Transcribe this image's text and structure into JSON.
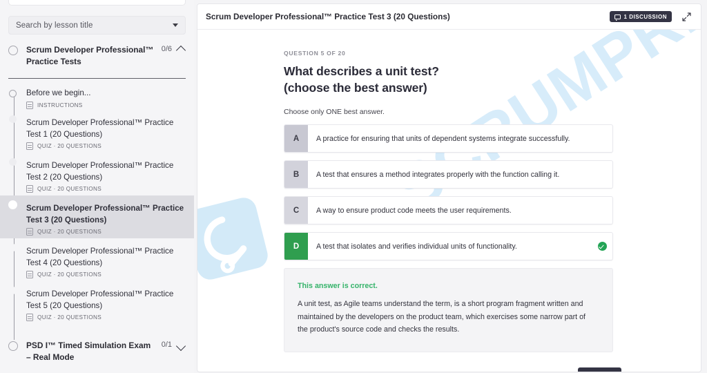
{
  "sidebar": {
    "search": {
      "placeholder": "Search by lesson title",
      "caret_icon": "chevron-down-icon"
    },
    "sections": [
      {
        "title": "Scrum Developer Professional™ Practice Tests",
        "count": "0/6",
        "state": "expanded",
        "chevron_icon": "chevron-up-icon"
      },
      {
        "title": "PSD I™ Timed Simulation Exam – Real Mode",
        "count": "0/1",
        "state": "collapsed",
        "chevron_icon": "chevron-down-icon"
      }
    ],
    "lessons": [
      {
        "title": "Before we begin...",
        "meta": "INSTRUCTIONS",
        "active": false
      },
      {
        "title": "Scrum Developer Professional™ Practice Test 1 (20 Questions)",
        "meta": "QUIZ · 20 QUESTIONS",
        "active": false
      },
      {
        "title": "Scrum Developer Professional™ Practice Test 2 (20 Questions)",
        "meta": "QUIZ · 20 QUESTIONS",
        "active": false
      },
      {
        "title": "Scrum Developer Professional™ Practice Test 3 (20 Questions)",
        "meta": "QUIZ · 20 QUESTIONS",
        "active": true
      },
      {
        "title": "Scrum Developer Professional™ Practice Test 4 (20 Questions)",
        "meta": "QUIZ · 20 QUESTIONS",
        "active": false
      },
      {
        "title": "Scrum Developer Professional™ Practice Test 5 (20 Questions)",
        "meta": "QUIZ · 20 QUESTIONS",
        "active": false
      }
    ]
  },
  "header": {
    "title": "Scrum Developer Professional™ Practice Test 3 (20 Questions)",
    "discussion_label": "1 DISCUSSION",
    "discussion_icon": "comment-bubble-icon",
    "expand_icon": "expand-arrows-icon"
  },
  "quiz": {
    "question_counter": "QUESTION 5 OF 20",
    "question_line1": "What describes a unit test?",
    "question_line2": "(choose the best answer)",
    "hint": "Choose only ONE best answer.",
    "options": [
      {
        "letter": "A",
        "text": "A practice for ensuring that units of dependent systems integrate successfully.",
        "selected": false,
        "correct": false
      },
      {
        "letter": "B",
        "text": "A test that ensures a method integrates properly with the function calling it.",
        "selected": false,
        "correct": false
      },
      {
        "letter": "C",
        "text": "A way to ensure product code meets the user requirements.",
        "selected": false,
        "correct": false
      },
      {
        "letter": "D",
        "text": "A test that isolates and verifies individual units of functionality.",
        "selected": true,
        "correct": true
      }
    ],
    "feedback": {
      "heading": "This answer is correct.",
      "body": "A unit test, as Agile teams understand the term, is a short program fragment written and maintained by the developers on the product team, which exercises some narrow part of the product's source code and checks the results."
    }
  },
  "watermark": {
    "text": "SCRUMPREP",
    "color": "#d7ecfa"
  },
  "colors": {
    "correct_green": "#2f9e4f",
    "correct_text_green": "#35b36a",
    "dark_badge": "#343444",
    "sidebar_bg": "#f5f5f7",
    "active_row": "#dcdce1"
  }
}
